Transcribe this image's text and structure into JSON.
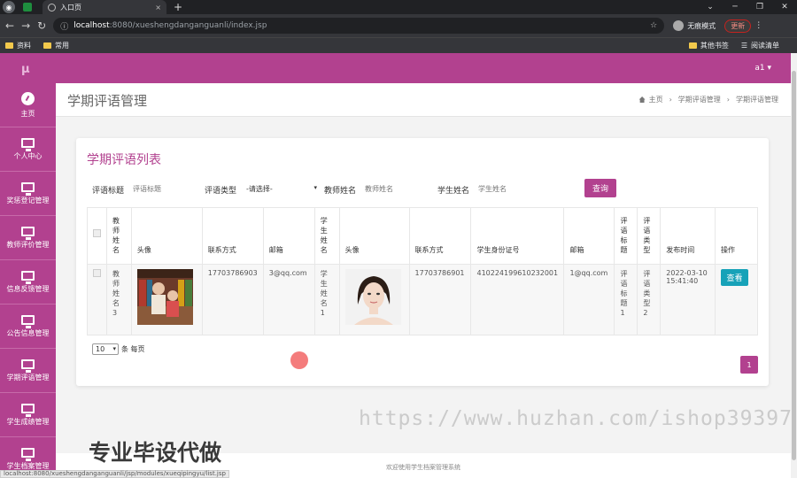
{
  "browser": {
    "tab_title": "入口页",
    "url_host": "localhost",
    "url_path": ":8080/xueshengdanganguanli/index.jsp",
    "profile_label": "无痕模式",
    "update_label": "更新",
    "bookmarks": [
      "资料",
      "常用"
    ],
    "bookmarks_right": [
      "其他书签",
      "阅读清单"
    ]
  },
  "app": {
    "logo": "μ",
    "user": "a1 ▾",
    "sidebar": [
      {
        "label": "主页",
        "icon": "dashboard-icon"
      },
      {
        "label": "个人中心",
        "icon": "monitor-icon"
      },
      {
        "label": "奖惩登记管理",
        "icon": "monitor-icon"
      },
      {
        "label": "教师评价管理",
        "icon": "monitor-icon"
      },
      {
        "label": "信息反馈管理",
        "icon": "monitor-icon"
      },
      {
        "label": "公告信息管理",
        "icon": "monitor-icon"
      },
      {
        "label": "学期评语管理",
        "icon": "monitor-icon"
      },
      {
        "label": "学生成绩管理",
        "icon": "monitor-icon"
      },
      {
        "label": "学生档案管理",
        "icon": "monitor-icon"
      }
    ],
    "page_title": "学期评语管理",
    "breadcrumb": [
      "主页",
      "学期评语管理",
      "学期评语管理"
    ]
  },
  "list": {
    "title": "学期评语列表",
    "filters": {
      "comment_title_label": "评语标题",
      "comment_title_placeholder": "评语标题",
      "comment_type_label": "评语类型",
      "comment_type_value": "-请选择-",
      "teacher_name_label": "教师姓名",
      "teacher_name_placeholder": "教师姓名",
      "student_name_label": "学生姓名",
      "student_name_placeholder": "学生姓名",
      "search_button": "查询"
    },
    "columns": [
      "教师姓名",
      "头像",
      "联系方式",
      "邮箱",
      "学生姓名",
      "头像",
      "联系方式",
      "学生身份证号",
      "邮箱",
      "评语标题",
      "评语类型",
      "发布时间",
      "操作"
    ],
    "rows": [
      {
        "teacher_name": "教师姓名3",
        "teacher_phone": "17703786903",
        "teacher_email": "3@qq.com",
        "student_name": "学生姓名1",
        "student_phone": "17703786901",
        "student_id": "410224199610232001",
        "student_email": "1@qq.com",
        "comment_title": "评语标题1",
        "comment_type": "评语类型2",
        "publish_time": "2022-03-10 15:41:40",
        "action": "查看"
      }
    ],
    "page_size": "10",
    "page_size_suffix": "条 每页",
    "current_page": "1"
  },
  "footer": "欢迎使用学生档案管理系统",
  "status_url": "localhost:8080/xueshengdanganguanli/jsp/modules/xueqipingyu/list.jsp",
  "overlay": {
    "watermark": "https://www.huzhan.com/ishop39397",
    "promo": "专业毕设代做"
  },
  "colors": {
    "primary": "#b2418f",
    "info": "#17a2b8"
  }
}
